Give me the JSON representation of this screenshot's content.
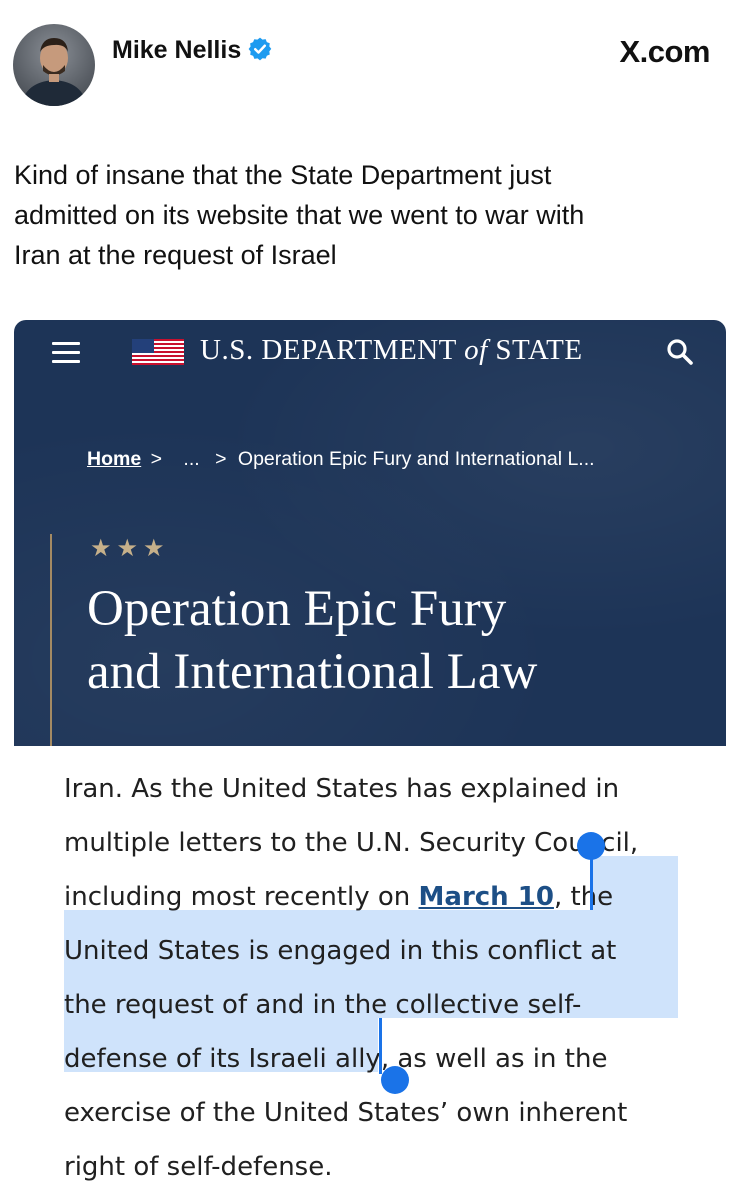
{
  "tweet": {
    "author": "Mike Nellis",
    "brand": "X.com",
    "text": "Kind of insane that the State Department just admitted on its website that we went to war with Iran at the request of Israel",
    "text_lines": [
      "Kind of insane that the State Department just",
      "admitted on its website that we went to war with",
      "Iran at the request of Israel"
    ]
  },
  "site": {
    "title_main": "U.S. DEPARTMENT ",
    "title_of": "of",
    "title_end": " STATE",
    "breadcrumb": {
      "home": "Home",
      "sep1": ">",
      "ellipsis": "...",
      "sep2": ">",
      "current": "Operation Epic Fury and International L..."
    },
    "stars": "★★★",
    "page_title_line1": "Operation Epic Fury",
    "page_title_line2": "and International Law"
  },
  "article": {
    "line1": "Iran. As the United States has explained in",
    "line2": "multiple letters to the U.N. Security Council,",
    "line3_before": "including most recently on ",
    "line3_link": "March 10",
    "line3_after": ", the",
    "line4": "United States is engaged in this conflict at",
    "line5": "the request of and in the collective self-",
    "line6_before": "defense of its Israeli ally",
    "line6_after": ", as well as in the",
    "line7": "exercise of the United States’ own inherent",
    "line8": "right of self-defense."
  },
  "colors": {
    "site_background": "#1d3457",
    "accent_gold": "#c6b08a",
    "selection_highlight": "#cfe3fb",
    "selection_handle": "#1a73e8",
    "link": "#1d4f86",
    "verified_badge": "#1d9bf0"
  },
  "icons": [
    "verified-badge-icon",
    "menu-icon",
    "us-flag-icon",
    "search-icon"
  ]
}
